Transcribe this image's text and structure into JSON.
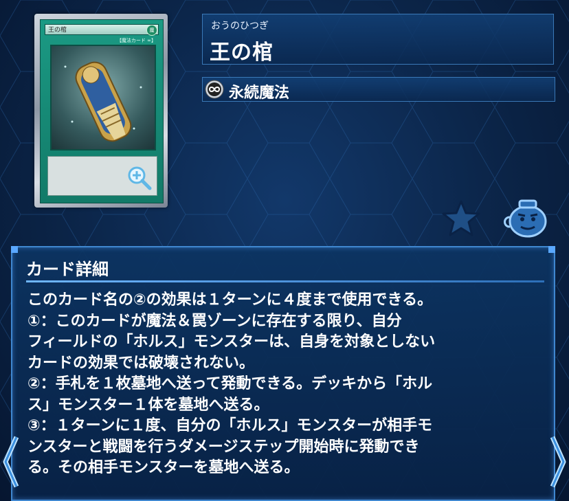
{
  "card": {
    "mini_name": "王の棺",
    "mini_attribute": "魔",
    "mini_type_line": "【魔法カード ∞】"
  },
  "header": {
    "furigana": "おうのひつぎ",
    "title": "王の棺"
  },
  "type": {
    "label": "永続魔法",
    "icon": "continuous-spell-icon"
  },
  "buttons": {
    "favorite_icon": "star-icon",
    "deck_icon": "deck-pot-icon"
  },
  "detail": {
    "heading": "カード詳細",
    "text": "このカード名の②の効果は１ターンに４度まで使用できる。\n①：このカードが魔法＆罠ゾーンに存在する限り、自分\nフィールドの「ホルス」モンスターは、自身を対象としない\nカードの効果では破壊されない。\n②：手札を１枚墓地へ送って発動できる。デッキから「ホル\nス」モンスター１体を墓地へ送る。\n③：１ターンに１度、自分の「ホルス」モンスターが相手モ\nンスターと戦闘を行うダメージステップ開始時に発動でき\nる。その相手モンスターを墓地へ送る。"
  },
  "colors": {
    "spell_green": "#1b9a84",
    "panel_border": "#3a79b8",
    "accent_blue": "#5aa8ff"
  }
}
